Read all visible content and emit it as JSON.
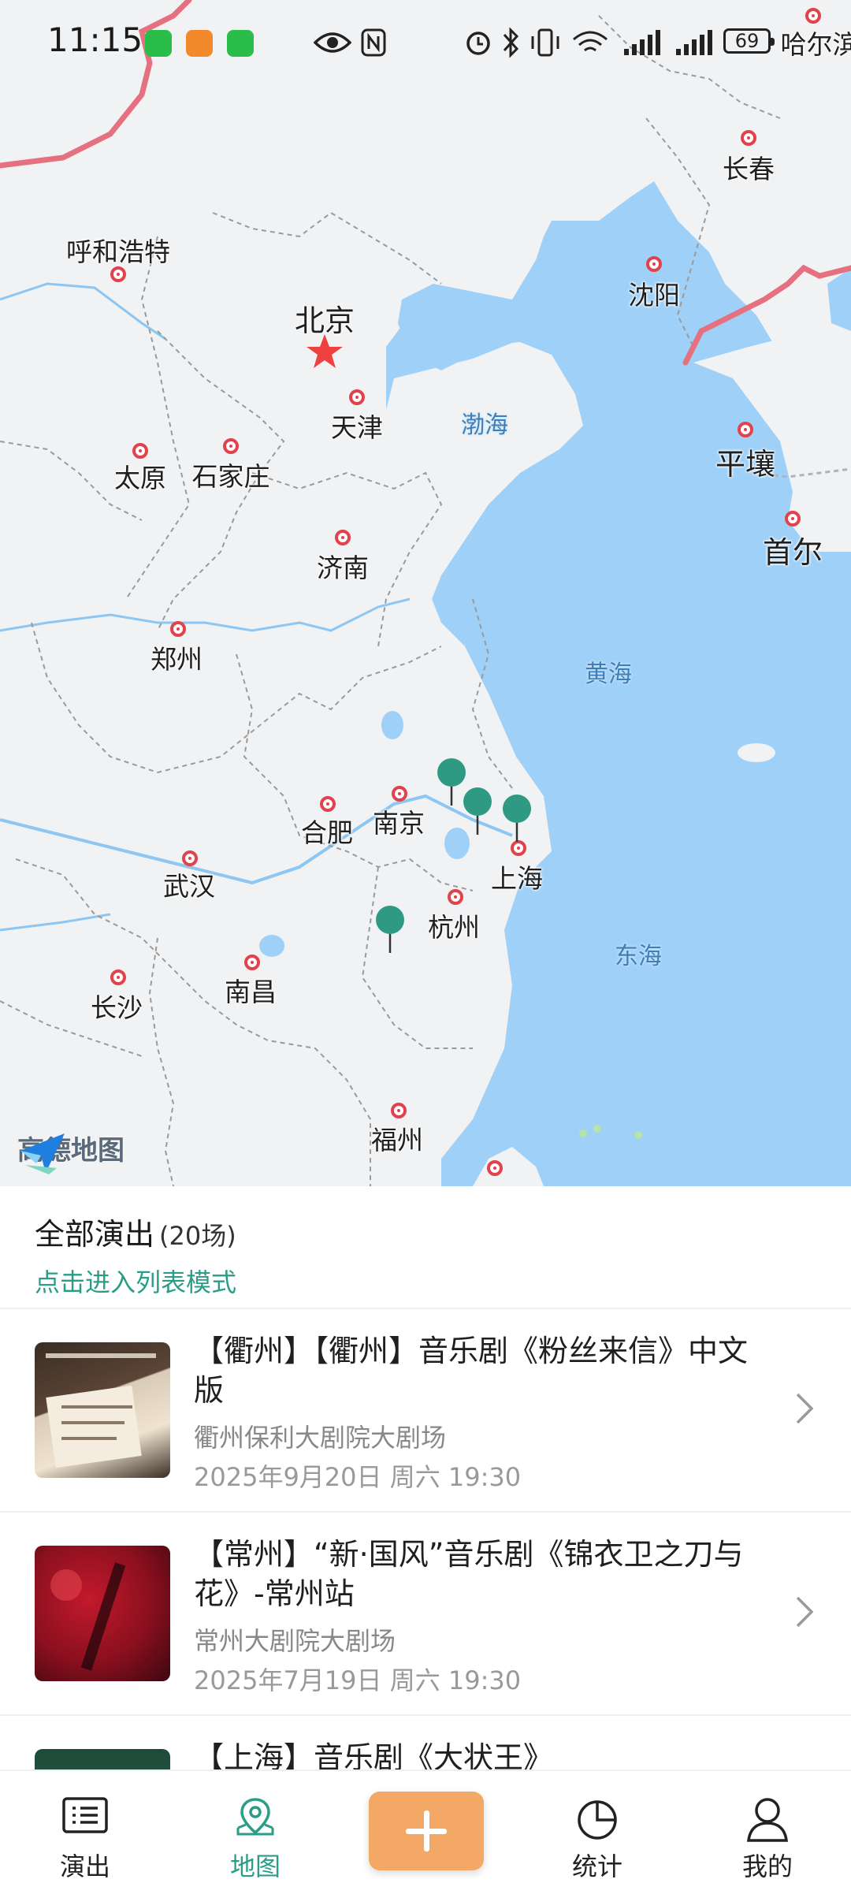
{
  "status_bar": {
    "time": "11:15",
    "battery": "69",
    "icons": [
      "wechat-icon",
      "taobao-icon",
      "wechat-icon",
      "eye-icon",
      "nfc-icon",
      "alarm-icon",
      "bluetooth-icon",
      "vibrate-icon",
      "wifi-icon",
      "signal-icon",
      "signal-icon"
    ]
  },
  "map": {
    "provider": "高德地图",
    "cities": [
      {
        "name": "哈尔滨",
        "big": false
      },
      {
        "name": "长春",
        "big": false
      },
      {
        "name": "呼和浩特",
        "big": false
      },
      {
        "name": "沈阳",
        "big": false
      },
      {
        "name": "北京",
        "big": true
      },
      {
        "name": "天津",
        "big": false
      },
      {
        "name": "太原",
        "big": false
      },
      {
        "name": "石家庄",
        "big": false
      },
      {
        "name": "平壤",
        "big": true
      },
      {
        "name": "首尔",
        "big": true
      },
      {
        "name": "济南",
        "big": false
      },
      {
        "name": "郑州",
        "big": false
      },
      {
        "name": "合肥",
        "big": false
      },
      {
        "name": "南京",
        "big": false
      },
      {
        "name": "上海",
        "big": false
      },
      {
        "name": "武汉",
        "big": false
      },
      {
        "name": "杭州",
        "big": false
      },
      {
        "name": "长沙",
        "big": false
      },
      {
        "name": "南昌",
        "big": false
      },
      {
        "name": "福州",
        "big": false
      }
    ],
    "seas": [
      "渤海",
      "黄海",
      "东海"
    ],
    "accent_color": "#2a9d87",
    "marker_color": "#2f9a84"
  },
  "sheet": {
    "title": "全部演出",
    "count": "(20场)",
    "list_mode_link": "点击进入列表模式",
    "items": [
      {
        "title": "【衢州】【衢州】音乐剧《粉丝来信》中文版",
        "venue": "衢州保利大剧院大剧场",
        "date": "2025年9月20日 周六 19:30"
      },
      {
        "title": "【常州】“新·国风”音乐剧《锦衣卫之刀与花》-常州站",
        "venue": "常州大剧院大剧场",
        "date": "2025年7月19日 周六 19:30"
      },
      {
        "title": "【上海】音乐剧《大状王》",
        "venue": "",
        "date": ""
      }
    ]
  },
  "tabbar": {
    "tabs": [
      {
        "label": "演出",
        "icon": "list-icon"
      },
      {
        "label": "地图",
        "icon": "map-pin-icon"
      },
      {
        "label": "",
        "icon": "plus-icon"
      },
      {
        "label": "统计",
        "icon": "pie-chart-icon"
      },
      {
        "label": "我的",
        "icon": "user-icon"
      }
    ],
    "active": "地图"
  }
}
